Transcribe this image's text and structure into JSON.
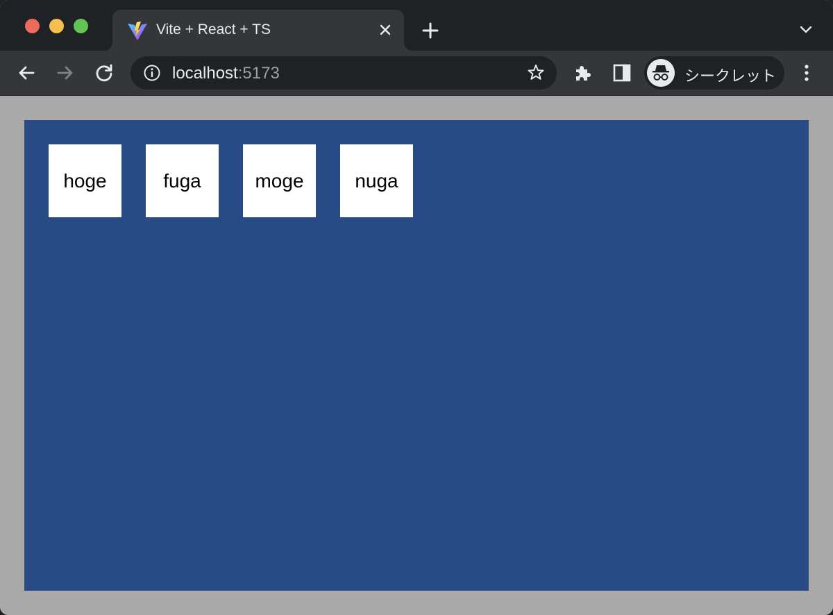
{
  "browser": {
    "tab": {
      "title": "Vite + React + TS",
      "favicon": "vite-logo-icon"
    },
    "address_bar": {
      "host": "localhost",
      "port": ":5173"
    },
    "profile": {
      "label": "シークレット",
      "icon": "incognito-icon"
    },
    "toolbar_icons": [
      "back-arrow-icon",
      "forward-arrow-icon",
      "reload-icon",
      "extensions-puzzle-icon",
      "side-panel-icon",
      "more-vert-icon"
    ]
  },
  "page": {
    "background_color": "#a9a9a9",
    "container_color": "#294b85",
    "boxes": [
      {
        "label": "hoge"
      },
      {
        "label": "fuga"
      },
      {
        "label": "moge"
      },
      {
        "label": "nuga"
      }
    ]
  }
}
